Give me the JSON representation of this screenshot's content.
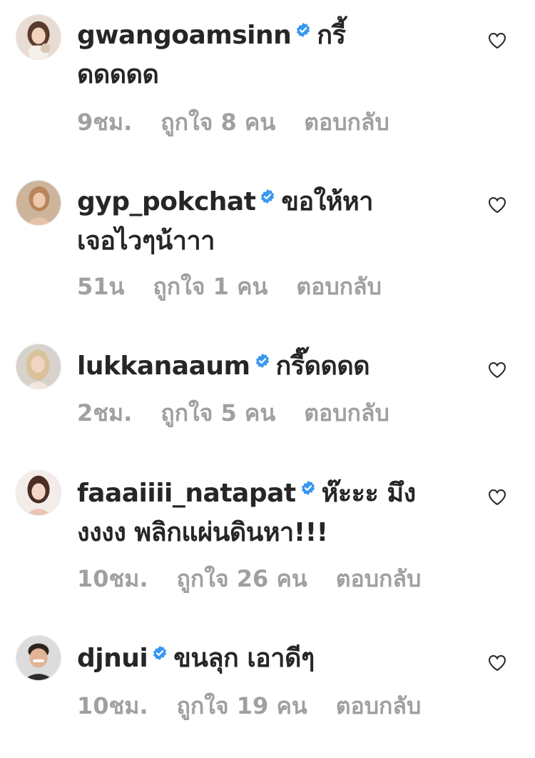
{
  "colors": {
    "text": "#262626",
    "meta": "#a0a0a0",
    "verified": "#3897f0",
    "background": "#ffffff"
  },
  "comments": [
    {
      "username": "gwangoamsinn",
      "verified": true,
      "text_line1": "กรี้",
      "text_line2": "ดดดดด",
      "time": "9ชม.",
      "likes_prefix": "ถูกใจ",
      "likes_count": "8",
      "likes_suffix": "คน",
      "reply": "ตอบกลับ",
      "icon": "heart-outline-icon"
    },
    {
      "username": "gyp_pokchat",
      "verified": true,
      "text_line1": "ขอให้หา",
      "text_line2": "เจอไวๆน้าาา",
      "time": "51น",
      "likes_prefix": "ถูกใจ",
      "likes_count": "1",
      "likes_suffix": "คน",
      "reply": "ตอบกลับ",
      "icon": "heart-outline-icon"
    },
    {
      "username": "lukkanaaum",
      "verified": true,
      "text_line1": "กรี๊ดดดด",
      "text_line2": "",
      "time": "2ชม.",
      "likes_prefix": "ถูกใจ",
      "likes_count": "5",
      "likes_suffix": "คน",
      "reply": "ตอบกลับ",
      "icon": "heart-outline-icon"
    },
    {
      "username": "faaaiiii_natapat",
      "verified": true,
      "text_line1": "ห๊ะะะ มึง",
      "text_line2": "งงงง พลิกแผ่นดินหา!!!",
      "time": "10ชม.",
      "likes_prefix": "ถูกใจ",
      "likes_count": "26",
      "likes_suffix": "คน",
      "reply": "ตอบกลับ",
      "icon": "heart-outline-icon"
    },
    {
      "username": "djnui",
      "verified": true,
      "text_line1": "ขนลุก เอาดีๆ",
      "text_line2": "",
      "time": "10ชม.",
      "likes_prefix": "ถูกใจ",
      "likes_count": "19",
      "likes_suffix": "คน",
      "reply": "ตอบกลับ",
      "icon": "heart-outline-icon"
    }
  ]
}
